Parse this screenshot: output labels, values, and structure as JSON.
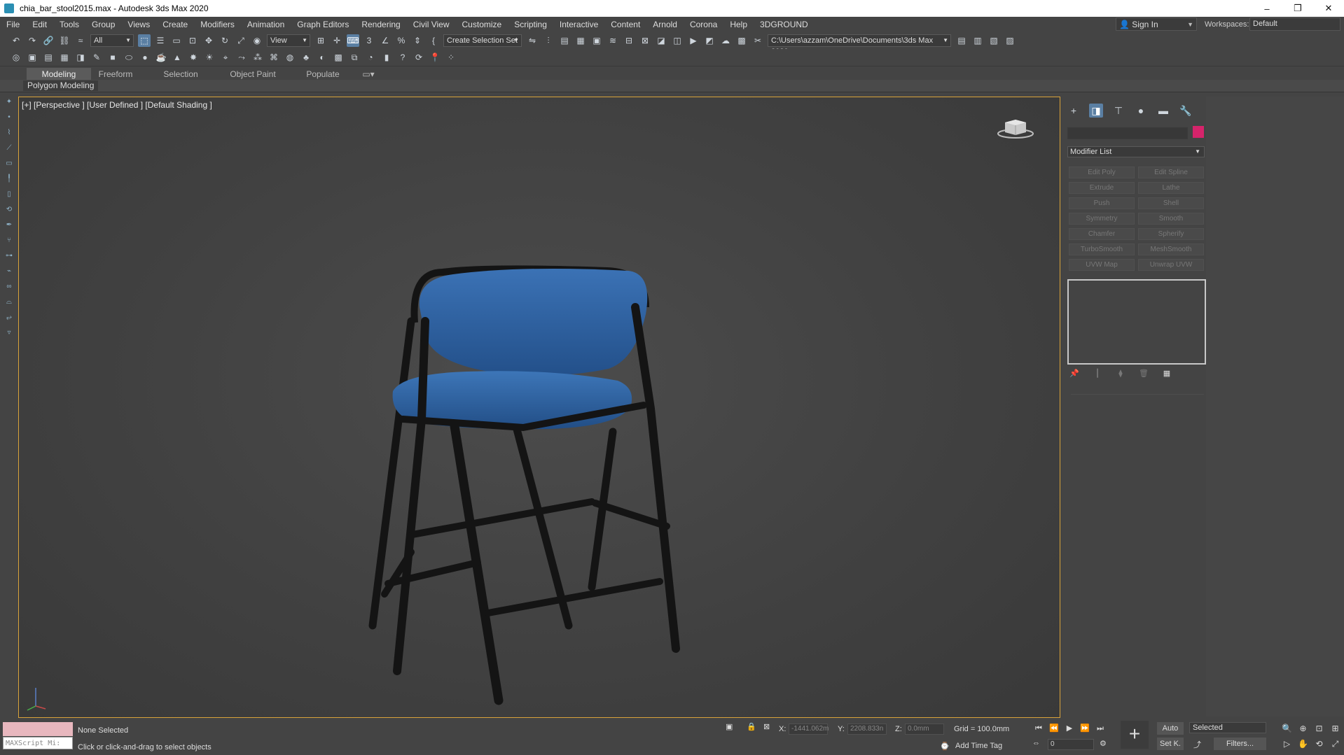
{
  "window": {
    "title": "chia_bar_stool2015.max - Autodesk 3ds Max 2020",
    "controls": [
      "–",
      "❐",
      "✕"
    ]
  },
  "menu": {
    "items": [
      "File",
      "Edit",
      "Tools",
      "Group",
      "Views",
      "Create",
      "Modifiers",
      "Animation",
      "Graph Editors",
      "Rendering",
      "Civil View",
      "Customize",
      "Scripting",
      "Interactive",
      "Content",
      "Arnold",
      "Corona",
      "Help",
      "3DGROUND"
    ],
    "sign_in": "Sign In",
    "workspaces_label": "Workspaces:",
    "workspace_value": "Default"
  },
  "toolbar": {
    "filter_value": "All",
    "ref_coord_value": "View",
    "selection_set": "Create Selection Set",
    "project_path": "C:\\Users\\azzam\\OneDrive\\Documents\\3ds Max 2020"
  },
  "ribbon": {
    "tabs": [
      "Modeling",
      "Freeform",
      "Selection",
      "Object Paint",
      "Populate"
    ],
    "active_tab": "Modeling",
    "panel": "Polygon Modeling"
  },
  "viewport": {
    "label": "[+] [Perspective ] [User Defined ] [Default Shading ]",
    "colors": {
      "seat": "#2e5f9e",
      "frame": "#141414"
    }
  },
  "command_panel": {
    "modifier_list": "Modifier List",
    "object_color": "#d6246b",
    "modifiers": [
      "Edit Poly",
      "Edit Spline",
      "Extrude",
      "Lathe",
      "Push",
      "Shell",
      "Symmetry",
      "Smooth",
      "Chamfer",
      "Spherify",
      "TurboSmooth",
      "MeshSmooth",
      "UVW Map",
      "Unwrap UVW"
    ]
  },
  "status": {
    "maxscript": "MAXScript Mi:",
    "selection": "None Selected",
    "prompt": "Click or click-and-drag to select objects",
    "x_label": "X:",
    "x_value": "-1441.062m",
    "y_label": "Y:",
    "y_value": "2208.833n",
    "z_label": "Z:",
    "z_value": "0.0mm",
    "grid": "Grid = 100.0mm",
    "add_time_tag": "Add Time Tag",
    "frame": "0",
    "auto": "Auto",
    "set_key": "Set K.",
    "selected": "Selected",
    "filters": "Filters..."
  }
}
